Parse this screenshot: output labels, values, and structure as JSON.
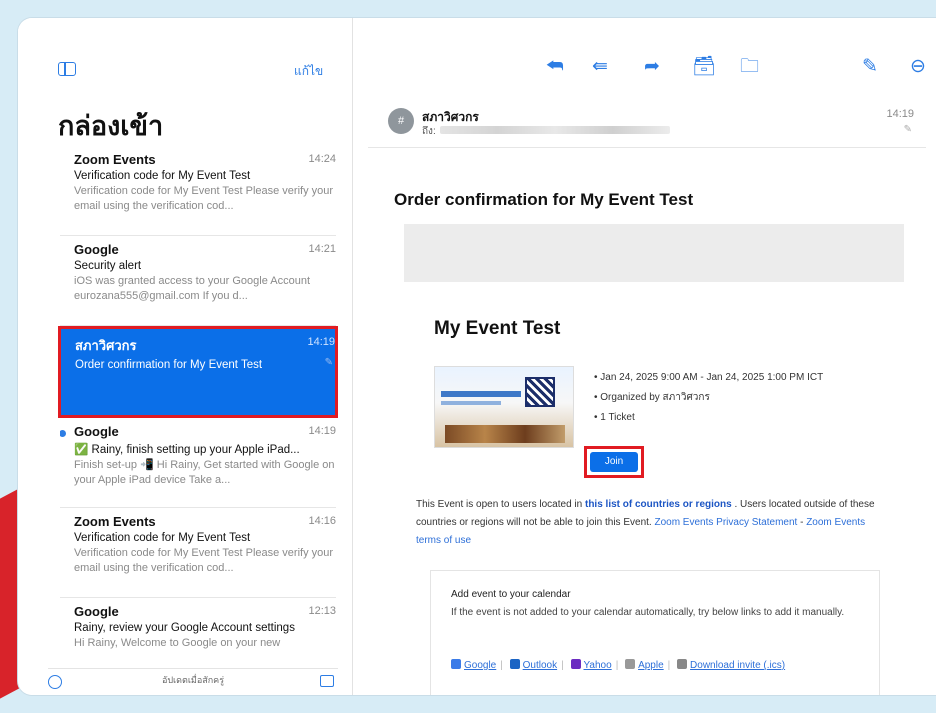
{
  "left_pane": {
    "edit_label": "แก้ไข",
    "title": "กล่องเข้า",
    "messages": [
      {
        "sender": "Zoom Events",
        "time": "14:24",
        "subject": "Verification code for My Event Test",
        "preview": "Verification code for My Event Test Please verify your email using the verification cod..."
      },
      {
        "sender": "Google",
        "time": "14:21",
        "subject": "Security alert",
        "preview": "iOS was granted access to your Google Account eurozana555@gmail.com If you d..."
      },
      {
        "sender": "สภาวิศวกร",
        "time": "14:19",
        "subject": "Order confirmation for My Event Test",
        "preview": "",
        "selected": true
      },
      {
        "sender": "Google",
        "time": "14:19",
        "subject": "✅ Rainy, finish setting up your Apple iPad...",
        "preview": "Finish set-up 📲 Hi Rainy, Get started with Google on your Apple iPad device Take a...",
        "unread": true
      },
      {
        "sender": "Zoom Events",
        "time": "14:16",
        "subject": "Verification code for My Event Test",
        "preview": "Verification code for My Event Test Please verify your email using the verification cod..."
      },
      {
        "sender": "Google",
        "time": "12:13",
        "subject": "Rainy, review your Google Account settings",
        "preview": "Hi Rainy, Welcome to Google on your new"
      }
    ],
    "bottom_status": "อัปเดตเมื่อสักครู่"
  },
  "toolbar": {
    "icons": [
      "reply-icon",
      "reply-all-icon",
      "forward-icon",
      "archive-icon",
      "folder-icon",
      "compose-icon",
      "more-icon"
    ]
  },
  "header": {
    "from_name": "สภาวิศวกร",
    "to_label": "ถึง:",
    "time": "14:19",
    "avatar_initial": "#"
  },
  "email": {
    "subject": "Order confirmation for My Event Test",
    "event_title": "My Event Test",
    "details": [
      "Jan 24, 2025 9:00 AM - Jan 24, 2025 1:00 PM ICT",
      "Organized by สภาวิศวกร",
      "1 Ticket"
    ],
    "join_label": "Join",
    "notice_pre": "This Event is open to users located in ",
    "notice_link": "this list of countries or regions",
    "notice_mid": " . Users located outside of these countries or regions will not be able to join this Event. ",
    "privacy_link": "Zoom Events Privacy Statement",
    "dash": " - ",
    "terms_link": "Zoom Events terms of use",
    "calendar": {
      "title": "Add event to your calendar",
      "text": "If the event is not added to your calendar automatically, try below links to add it manually.",
      "links": [
        "Google",
        "Outlook",
        "Yahoo",
        "Apple",
        "Download invite (.ics)"
      ]
    }
  },
  "colors": {
    "accent": "#2d7de4",
    "selected_bg": "#0b6fe8",
    "highlight_border": "#e11b22"
  }
}
